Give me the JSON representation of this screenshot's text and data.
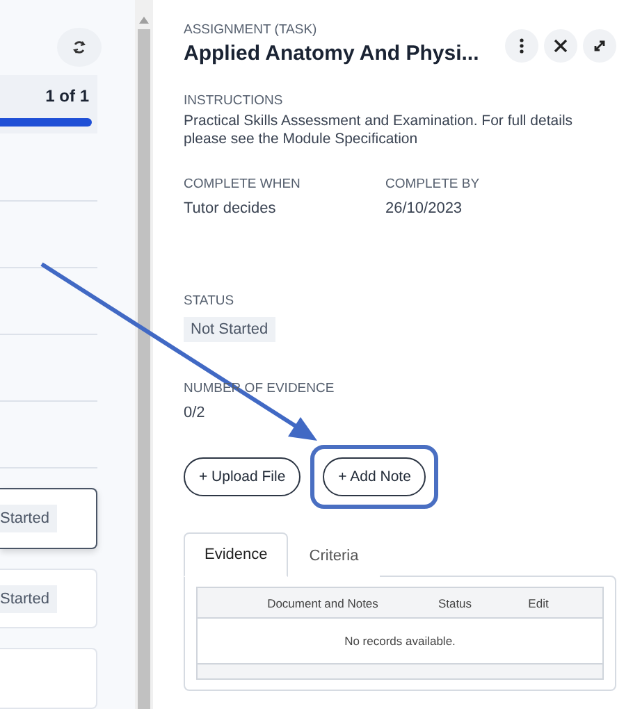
{
  "left_panel": {
    "progress": {
      "label": "1 of 1"
    },
    "cards": [
      {
        "status": "Started",
        "selected": true
      },
      {
        "status": "Started",
        "selected": false
      },
      {
        "selected": false
      }
    ]
  },
  "detail": {
    "type_label": "ASSIGNMENT (TASK)",
    "title": "Applied Anatomy And Physi...",
    "instructions_label": "INSTRUCTIONS",
    "instructions": "Practical Skills Assessment and Examination. For full details please see the Module Specification",
    "fields": [
      {
        "label": "COMPLETE WHEN",
        "value": "Tutor decides"
      },
      {
        "label": "COMPLETE BY",
        "value": "26/10/2023"
      }
    ],
    "status_label": "STATUS",
    "status": "Not Started",
    "evidence_label": "NUMBER OF EVIDENCE",
    "evidence": "0/2",
    "buttons": [
      {
        "label": "+ Upload File",
        "highlighted": false
      },
      {
        "label": "+ Add Note",
        "highlighted": true
      }
    ],
    "tabs": [
      {
        "label": "Evidence",
        "selected": true
      },
      {
        "label": "Criteria",
        "selected": false
      }
    ],
    "table": {
      "columns": [
        "Document and Notes",
        "Status",
        "Edit"
      ],
      "empty": "No records available."
    }
  }
}
